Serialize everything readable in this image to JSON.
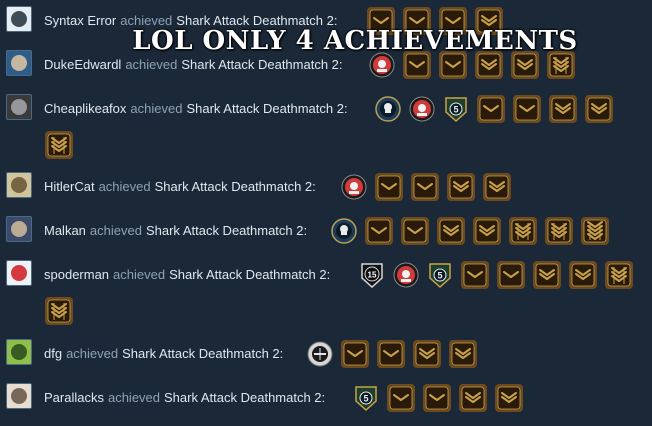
{
  "overlay": {
    "caption": "LOL ONLY 4 ACHIEVEMENTS"
  },
  "feed": {
    "verb": "achieved",
    "game": "Shark Attack Deathmatch 2:",
    "entries": [
      {
        "user": "Syntax Error",
        "avatar": "tie-figure-avatar",
        "badges": [
          "chevron-1",
          "chevron-1",
          "chevron-2",
          "chevron-3"
        ]
      },
      {
        "user": "DukeEdwardl",
        "avatar": "painting-avatar",
        "badges": [
          "red-medal",
          "chevron-1",
          "chevron-2",
          "chevron-3",
          "chevron-4",
          "chevron-5"
        ]
      },
      {
        "user": "Cheaplikeafox",
        "avatar": "gasmask-avatar",
        "badges": [
          "skull-medal",
          "red-medal",
          "star-5",
          "chevron-1",
          "chevron-2",
          "chevron-3",
          "chevron-4",
          "chevron-5"
        ]
      },
      {
        "user": "HitlerCat",
        "avatar": "cat-avatar",
        "badges": [
          "red-medal",
          "chevron-1",
          "chevron-2",
          "chevron-3",
          "chevron-4"
        ]
      },
      {
        "user": "Malkan",
        "avatar": "soldier-avatar",
        "badges": [
          "skull-medal",
          "chevron-1",
          "chevron-2",
          "chevron-3",
          "chevron-4",
          "chevron-5",
          "chevron-6",
          "chevron-7"
        ]
      },
      {
        "user": "spoderman",
        "avatar": "spider-avatar",
        "badges": [
          "round-15",
          "red-medal",
          "star-5",
          "chevron-1",
          "chevron-2",
          "chevron-3",
          "chevron-4",
          "chevron-5",
          "chevron-6"
        ]
      },
      {
        "user": "dfg",
        "avatar": "tree-avatar",
        "badges": [
          "sword-medal",
          "chevron-1",
          "chevron-2",
          "chevron-3",
          "chevron-4"
        ]
      },
      {
        "user": "Parallacks",
        "avatar": "dog-avatar",
        "badges": [
          "star-5",
          "chevron-1",
          "chevron-2",
          "chevron-3",
          "chevron-4"
        ]
      }
    ]
  },
  "colors": {
    "background": "#1b2838",
    "bronze_outer": "#6b4a1f",
    "bronze_inner": "#2a1a0a",
    "bronze_highlight": "#c9a24a",
    "red_medal": "#d23b3b",
    "skull_medal_ring": "#1e3a55"
  }
}
